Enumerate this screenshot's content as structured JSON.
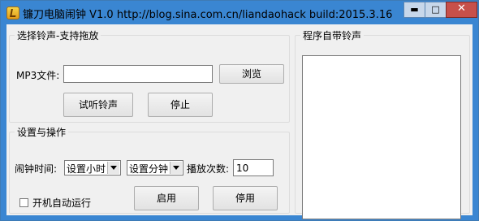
{
  "window": {
    "title": "镰刀电脑闹钟 V1.0    http://blog.sina.com.cn/liandaohack  build:2015.3.16",
    "controls": {
      "minimize": "▬",
      "maximize": "□",
      "close": "✕"
    }
  },
  "select_group": {
    "legend": "选择铃声-支持拖放",
    "mp3_label": "MP3文件:",
    "mp3_value": "",
    "browse_label": "浏览",
    "preview_label": "试听铃声",
    "stop_label": "停止"
  },
  "settings_group": {
    "legend": "设置与操作",
    "alarm_time_label": "闹钟时间:",
    "hour_select": "设置小时",
    "minute_select": "设置分钟",
    "play_count_label": "播放次数:",
    "play_count_value": "10",
    "autostart_label": "开机自动运行",
    "autostart_checked": false,
    "enable_label": "启用",
    "disable_label": "停用"
  },
  "tones_group": {
    "legend": "程序自带铃声",
    "items": []
  }
}
